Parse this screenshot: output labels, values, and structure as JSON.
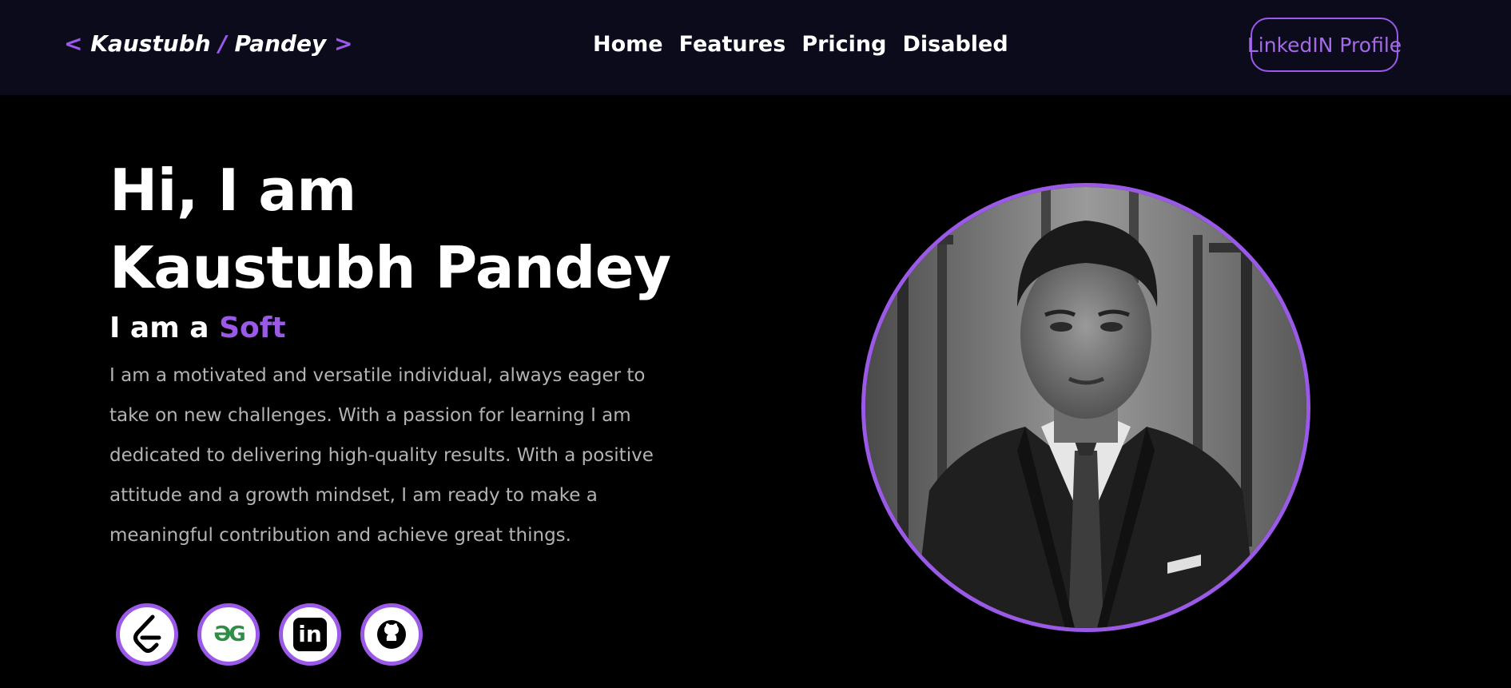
{
  "navbar": {
    "brand": {
      "open": "<",
      "first": "Kaustubh",
      "slash": "/",
      "last": "Pandey",
      "close": ">"
    },
    "links": [
      "Home",
      "Features",
      "Pricing",
      "Disabled"
    ],
    "cta_label": "LinkedIN Profile"
  },
  "hero": {
    "title_line1": "Hi, I am",
    "title_line2": "Kaustubh Pandey",
    "subtitle_prefix": "I am a",
    "subtitle_typed": "Soft",
    "bio": "I am a motivated and versatile individual, always eager to take on new challenges. With a passion for learning I am dedicated to delivering high-quality results. With a positive attitude and a growth mindset, I am ready to make a meaningful contribution and achieve great things."
  },
  "socials": [
    {
      "icon": "leetcode-icon"
    },
    {
      "icon": "geeksforgeeks-icon",
      "text": "ƏG"
    },
    {
      "icon": "linkedin-icon",
      "text": "in"
    },
    {
      "icon": "github-icon"
    }
  ],
  "colors": {
    "accent": "#9b59e8",
    "navbar_bg": "#0c0b1c",
    "page_bg": "#000000",
    "bio_text": "#b3b3b3",
    "gfg_green": "#2f8d46"
  }
}
